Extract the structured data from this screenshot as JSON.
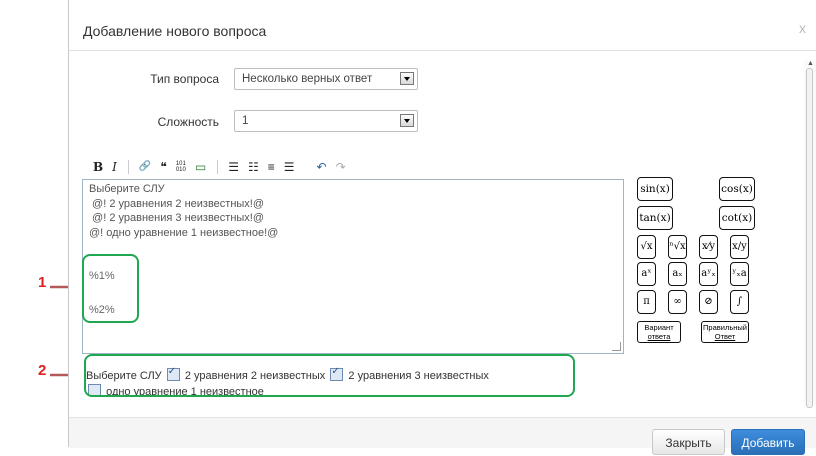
{
  "dialog": {
    "title": "Добавление нового вопроса",
    "close_icon": "x"
  },
  "form": {
    "type_label": "Тип вопроса",
    "type_value": "Несколько верных ответ",
    "difficulty_label": "Сложность",
    "difficulty_value": "1"
  },
  "toolbar": {
    "bold": "B",
    "italic": "I",
    "link": "🔗",
    "quote": "❝",
    "code": "101\n010",
    "image": "▭",
    "ol": "☰",
    "ul": "☷",
    "align": "≡",
    "indent": "☰",
    "undo": "↶",
    "redo": "↷"
  },
  "editor": {
    "lines": [
      "Выберите СЛУ",
      " @! 2 уравнения 2 неизвестных!@",
      " @! 2 уравнения 3 неизвестных!@",
      "@! одно уравнение 1 неизвестное!@"
    ],
    "placeholder1": "%1%",
    "placeholder2": "%2%"
  },
  "math_buttons": {
    "sin": "sin(x)",
    "cos": "cos(x)",
    "tan": "tan(x)",
    "cot": "cot(x)",
    "sqrt": "√x",
    "nroot": "ⁿ√x",
    "frac": "x⁄y",
    "div": "x/y",
    "pow": "aˣ",
    "sub": "aₓ",
    "subsup": "aʸₓ",
    "pre": "ʸₓa",
    "pi": "π",
    "inf": "∞",
    "empty": "⊘",
    "int": "∫",
    "variant_line1": "Вариант",
    "variant_line2": "ответа",
    "correct_line1": "Правильный",
    "correct_line2": "Ответ"
  },
  "preview": {
    "prefix": "Выберите СЛУ",
    "option1": "2 уравнения 2 неизвестных",
    "option2": "2 уравнения 3 неизвестных",
    "option3": "одно уравнение 1 неизвестное"
  },
  "markers": {
    "one": "1",
    "two": "2"
  },
  "footer": {
    "close_label": "Закрыть",
    "add_label": "Добавить"
  },
  "colors": {
    "highlight": "#1fa84f",
    "marker": "#e02020",
    "primary": "#2a6fb8"
  }
}
